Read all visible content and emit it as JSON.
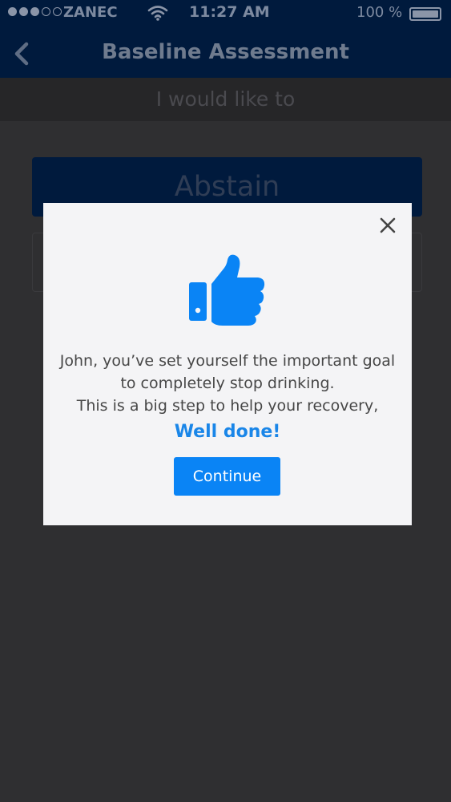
{
  "status_bar": {
    "carrier": "ZANEC",
    "time": "11:27 AM",
    "battery": "100 %"
  },
  "nav": {
    "title": "Baseline Assessment"
  },
  "subheader": {
    "text": "I would like to"
  },
  "options": {
    "abstain_label": "Abstain"
  },
  "modal": {
    "message_line1": "John, you’ve set yourself the important goal",
    "message_line2": "to completely stop drinking.",
    "message_line3": "This is a big step to help your recovery,",
    "highlight": "Well done!",
    "continue_label": "Continue",
    "colors": {
      "accent": "#0a84f5",
      "highlight": "#1a86e8"
    },
    "icons": {
      "hero": "thumbs-up-icon",
      "close": "close-icon"
    }
  }
}
